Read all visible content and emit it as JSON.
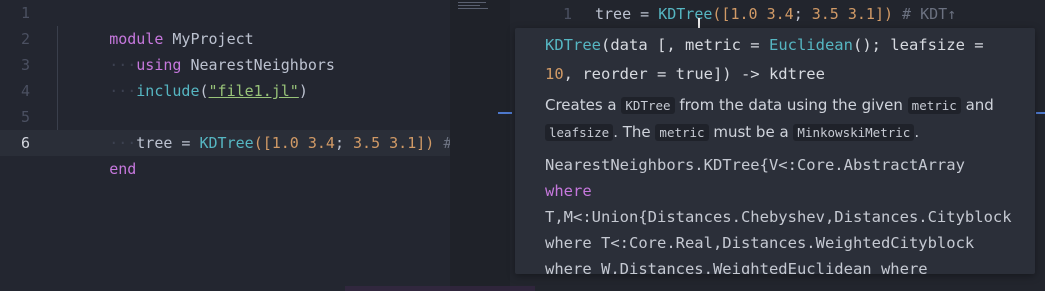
{
  "left_editor": {
    "line_numbers": [
      "1",
      "2",
      "3",
      "4",
      "5",
      "6"
    ],
    "active_line": "6",
    "lines": {
      "l1_kw": "module",
      "l1_name": " MyProject",
      "l2_ws": "···",
      "l2_kw": "using",
      "l2_name": " NearestNeighbors",
      "l3_ws": "···",
      "l3_fn": "include",
      "l3_open": "(",
      "l3_str": "\"file1.jl\"",
      "l3_close": ")",
      "l5_ws": "···",
      "l5_a": "tree = ",
      "l5_fn": "KDTree",
      "l5_open": "([",
      "l5_n1": "1.0",
      "l5_sp1": " ",
      "l5_n2": "3.4",
      "l5_semi": "; ",
      "l5_n3": "3.5",
      "l5_sp2": " ",
      "l5_n4": "3.1",
      "l5_close": "])",
      "l5_cmt": " #",
      "l6_kw": "end"
    }
  },
  "right_editor": {
    "line_number": "1",
    "code_a": "tree = ",
    "code_fn": "KDTree",
    "code_open": "([",
    "code_n1": "1.0",
    "code_sp1": " ",
    "code_n2": "3.4",
    "code_semi": "; ",
    "code_n3": "3.5",
    "code_sp2": " ",
    "code_n4": "3.1",
    "code_close": "])",
    "code_cmt": " # KDT↑"
  },
  "tooltip": {
    "sig_fn": "KDTree",
    "sig_a": "(data [, metric = ",
    "sig_metric": "Euclidean",
    "sig_b": "(); leafsize =",
    "sig_num": "10",
    "sig_c": ", reorder = true]) -> kdtree",
    "desc_a": "Creates a ",
    "desc_code1": "KDTree",
    "desc_b": " from the data using the given ",
    "desc_code2": "metric",
    "desc_c": " and ",
    "desc_code3": "leafsize",
    "desc_d": ". The ",
    "desc_code4": "metric",
    "desc_e": " must be a ",
    "desc_code5": "MinkowskiMetric",
    "desc_f": ".",
    "type_l1": "NearestNeighbors.KDTree{V<:Core.AbstractArray",
    "type_l2": "where",
    "type_l3": "T,M<:Union{Distances.Chebyshev,Distances.Cityblock",
    "type_l4": "where T<:Core.Real,Distances.WeightedCityblock",
    "type_l5": "where W,Distances.WeightedEuclidean where"
  },
  "colors": {
    "background": "#22252d",
    "keyword": "#c678dd",
    "function": "#56b6c2",
    "number": "#d19a66",
    "string": "#98c379",
    "tooltip_bg": "#2b2f39"
  }
}
